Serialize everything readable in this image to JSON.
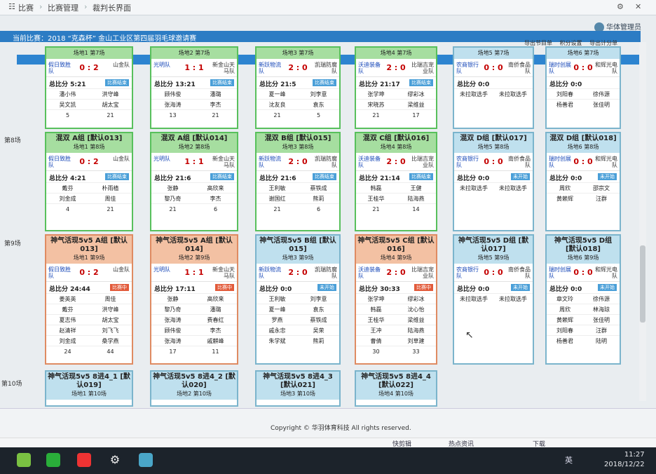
{
  "breadcrumb": {
    "root": "比赛",
    "mid": "比赛管理",
    "current": "裁判长界面"
  },
  "user": {
    "name": "华体管理员"
  },
  "subtitle": "当前比赛：2018 “克森杯” 金山工业区第四届羽毛球邀请赛",
  "toolbar": {
    "export_schedule": "导出节目单",
    "score_setting": "积分设置",
    "export_scores": "导出计分单"
  },
  "rounds": {
    "r8": "第8场",
    "r9": "第9场",
    "r10": "第10场"
  },
  "row1": [
    {
      "venue": "场地1 第7场",
      "team1": "假日致胜队",
      "team2": "山金队",
      "score": "0 : 2",
      "total": "总比分 5:21",
      "badge": "比赛结束",
      "p1": [
        "潘小伟",
        "吴文凯"
      ],
      "p2": [
        "洪守峰",
        "胡太宝"
      ],
      "s1": "5",
      "s2": "21"
    },
    {
      "venue": "场地2 第7场",
      "team1": "光明队",
      "team2": "新金山天马队",
      "score": "1 : 1",
      "total": "总比分 13:21",
      "badge": "比赛结束",
      "p1": [
        "顾伟俊",
        "张海涛"
      ],
      "p2": [
        "潘璐",
        "李杰"
      ],
      "s1": "13",
      "s2": "21"
    },
    {
      "venue": "场地3 第7场",
      "team1": "新跃物流队",
      "team2": "凯瑞防腐队",
      "score": "2 : 0",
      "total": "总比分 21:5",
      "badge": "比赛结束",
      "p1": [
        "夏一峰",
        "沈友良"
      ],
      "p2": [
        "刘李意",
        "袁东"
      ],
      "s1": "21",
      "s2": "5"
    },
    {
      "venue": "场地4 第7场",
      "team1": "沃迪装备队",
      "team2": "比瑞吉宠业队",
      "score": "2 : 0",
      "total": "总比分 21:17",
      "badge": "比赛结束",
      "p1": [
        "张学坤",
        "宋晓苏"
      ],
      "p2": [
        "缪彩冰",
        "梁维益"
      ],
      "s1": "21",
      "s2": "17"
    },
    {
      "venue": "场地5 第7场",
      "team1": "农商银行队",
      "team2": "南侨食品队",
      "score": "0 : 0",
      "total": "总比分 0:0",
      "badge": "",
      "p1": [
        "未拉取选手"
      ],
      "p2": [
        "未拉取选手"
      ],
      "s1": "",
      "s2": ""
    },
    {
      "venue": "场地6 第7场",
      "team1": "瑞时创展队",
      "team2": "和辉光电队",
      "score": "0 : 0",
      "total": "总比分 0:0",
      "badge": "",
      "p1": [
        "刘阳春",
        "杨善君"
      ],
      "p2": [
        "徐伟源",
        "张佳明"
      ],
      "s1": "",
      "s2": ""
    }
  ],
  "row2": [
    {
      "title": "混双 A组 [默认013]",
      "venue": "场地1 第8场",
      "team1": "假日致胜队",
      "team2": "山金队",
      "score": "0 : 2",
      "total": "总比分 4:21",
      "badge": "比赛结束",
      "p1": [
        "戴芬",
        "刘金成"
      ],
      "p2": [
        "朴雨植",
        "周佳"
      ],
      "s1": "4",
      "s2": "21"
    },
    {
      "title": "混双 A组 [默认014]",
      "venue": "场地2 第8场",
      "team1": "光明队",
      "team2": "新金山天马队",
      "score": "1 : 1",
      "total": "总比分 21:6",
      "badge": "比赛结束",
      "p1": [
        "张静",
        "黎乃奇"
      ],
      "p2": [
        "高欣来",
        "李杰"
      ],
      "s1": "21",
      "s2": "6"
    },
    {
      "title": "混双 B组 [默认015]",
      "venue": "场地3 第8场",
      "team1": "新跃物流队",
      "team2": "凯瑞防腐队",
      "score": "2 : 0",
      "total": "总比分 21:6",
      "badge": "比赛结束",
      "p1": [
        "王利敏",
        "谢国红"
      ],
      "p2": [
        "蔡铁成",
        "熊莉"
      ],
      "s1": "21",
      "s2": "6"
    },
    {
      "title": "混双 C组 [默认016]",
      "venue": "场地4 第8场",
      "team1": "沃迪装备队",
      "team2": "比瑞吉宠业队",
      "score": "2 : 0",
      "total": "总比分 21:14",
      "badge": "比赛结束",
      "p1": [
        "韩磊",
        "王桂华"
      ],
      "p2": [
        "王健",
        "陆海燕"
      ],
      "s1": "21",
      "s2": "14"
    },
    {
      "title": "混双 D组 [默认017]",
      "venue": "场地5 第8场",
      "team1": "农商银行队",
      "team2": "南侨食品队",
      "score": "0 : 0",
      "total": "总比分 0:0",
      "badge": "未开始",
      "p1": [
        "未拉取选手"
      ],
      "p2": [
        "未拉取选手"
      ],
      "s1": "",
      "s2": ""
    },
    {
      "title": "混双 D组 [默认018]",
      "venue": "场地6 第8场",
      "team1": "瑞时创展队",
      "team2": "和辉光电队",
      "score": "0 : 0",
      "total": "总比分 0:0",
      "badge": "未开始",
      "p1": [
        "周欣",
        "黄赖辉"
      ],
      "p2": [
        "邵宗文",
        "汪群"
      ],
      "s1": "",
      "s2": ""
    }
  ],
  "row3": [
    {
      "title": "神气活现5v5 A组 [默认013]",
      "venue": "场地1 第9场",
      "team1": "假日致胜队",
      "team2": "山金队",
      "score": "0 : 2",
      "total": "总比分 24:44",
      "badge": "比赛中",
      "p1": [
        "姜英英",
        "戴芬",
        "夏志伟",
        "赵清祥",
        "刘金成"
      ],
      "p2": [
        "周佳",
        "洪守峰",
        "胡太宝",
        "刘飞飞",
        "桑学燕"
      ],
      "s1": "24",
      "s2": "44"
    },
    {
      "title": "神气活现5v5 A组 [默认014]",
      "venue": "场地2 第9场",
      "team1": "光明队",
      "team2": "新金山天马队",
      "score": "1 : 1",
      "total": "总比分 17:11",
      "badge": "比赛中",
      "p1": [
        "张静",
        "黎乃奇",
        "张海涛",
        "顾伟俊",
        "张海涛"
      ],
      "p2": [
        "高欣来",
        "潘璐",
        "费春红",
        "李杰",
        "戚麒峰"
      ],
      "s1": "17",
      "s2": "11"
    },
    {
      "title": "神气活现5v5 B组 [默认015]",
      "venue": "场地3 第9场",
      "team1": "新跃物流队",
      "team2": "凯瑞防腐队",
      "score": "2 : 0",
      "total": "总比分 0:0",
      "badge": "未开始",
      "p1": [
        "王利敏",
        "夏一峰",
        "罗燕",
        "戚永忠",
        "朱学斌"
      ],
      "p2": [
        "刘李意",
        "袁东",
        "蔡铁成",
        "吴荣",
        "熊莉"
      ],
      "s1": "",
      "s2": ""
    },
    {
      "title": "神气活现5v5 C组 [默认016]",
      "venue": "场地4 第9场",
      "team1": "沃迪装备队",
      "team2": "比瑞吉宠业队",
      "score": "2 : 0",
      "total": "总比分 30:33",
      "badge": "比赛中",
      "p1": [
        "张学坤",
        "韩磊",
        "王桂华",
        "王冲",
        "曹倩"
      ],
      "p2": [
        "缪彩冰",
        "沈心怡",
        "梁维益",
        "陆海燕",
        "刘草建"
      ],
      "s1": "30",
      "s2": "33"
    },
    {
      "title": "神气活现5v5 D组 [默认017]",
      "venue": "场地5 第9场",
      "team1": "农商银行队",
      "team2": "南侨食品队",
      "score": "0 : 0",
      "total": "总比分 0:0",
      "badge": "未开始",
      "p1": [
        "未拉取选手"
      ],
      "p2": [
        "未拉取选手"
      ],
      "s1": "",
      "s2": ""
    },
    {
      "title": "神气活现5v5 D组 [默认018]",
      "venue": "场地6 第9场",
      "team1": "瑞时创展队",
      "team2": "和辉光电队",
      "score": "0 : 0",
      "total": "总比分 0:0",
      "badge": "未开始",
      "p1": [
        "章文玲",
        "周欣",
        "黄赖辉",
        "刘阳春",
        "杨善君"
      ],
      "p2": [
        "徐伟源",
        "林海琼",
        "张佳明",
        "汪群",
        "陆明"
      ],
      "s1": "",
      "s2": ""
    }
  ],
  "row4": [
    {
      "title": "神气活现5v5 8进4_1 [默认019]",
      "venue": "场地1 第10场"
    },
    {
      "title": "神气活现5v5 8进4_2 [默认020]",
      "venue": "场地2 第10场"
    },
    {
      "title": "神气活现5v5 8进4_3 [默认021]",
      "venue": "场地3 第10场"
    },
    {
      "title": "神气活现5v5 8进4_4 [默认022]",
      "venue": "场地4 第10场"
    }
  ],
  "footer": {
    "copyright": "Copyright © 华羽体育科技 All rights reserved."
  },
  "statusbar": {
    "kuaijianji": "快剪辑",
    "hotnews": "热点资讯",
    "download": "下载"
  },
  "clock": {
    "time": "11:27",
    "date": "2018/12/22"
  },
  "tray": {
    "ime": "英"
  },
  "colors": {
    "green_border": "#58c05c",
    "blue_border": "#7bb4cc",
    "orange_border": "#df8b62",
    "score_red": "#c40000",
    "brand_blue": "#2c7cc4"
  }
}
